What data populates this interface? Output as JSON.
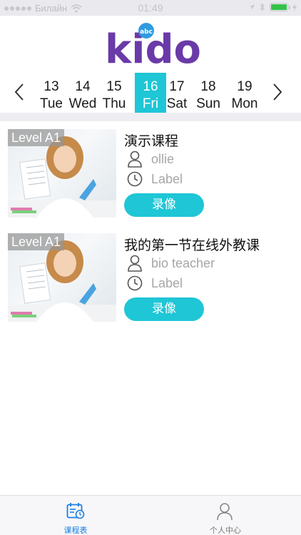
{
  "status_bar": {
    "carrier": "Билайн",
    "time": "01:49"
  },
  "logo": {
    "text": "kido",
    "badge": "abc"
  },
  "date_strip": {
    "days": [
      {
        "num": "13",
        "weekday": "Tue",
        "selected": false
      },
      {
        "num": "14",
        "weekday": "Wed",
        "selected": false
      },
      {
        "num": "15",
        "weekday": "Thu",
        "selected": false
      },
      {
        "num": "16",
        "weekday": "Fri",
        "selected": true
      },
      {
        "num": "17",
        "weekday": "Sat",
        "selected": false
      },
      {
        "num": "18",
        "weekday": "Sun",
        "selected": false
      },
      {
        "num": "19",
        "weekday": "Mon",
        "selected": false
      }
    ]
  },
  "courses": [
    {
      "level": "Level A1",
      "title": "演示课程",
      "teacher": "ollie",
      "time": "Label",
      "button": "录像"
    },
    {
      "level": "Level A1",
      "title": "我的第一节在线外教课",
      "teacher": "bio teacher",
      "time": "Label",
      "button": "录像"
    }
  ],
  "tabbar": {
    "tabs": [
      {
        "label": "课程表",
        "icon": "calendar-icon",
        "active": true
      },
      {
        "label": "个人中心",
        "icon": "person-icon",
        "active": false
      }
    ]
  },
  "colors": {
    "accent": "#1ec6d6",
    "tab_active": "#1a7ee6",
    "logo_purple": "#6a3aa8",
    "logo_orange": "#f5a623",
    "logo_blue": "#2f9be0"
  }
}
